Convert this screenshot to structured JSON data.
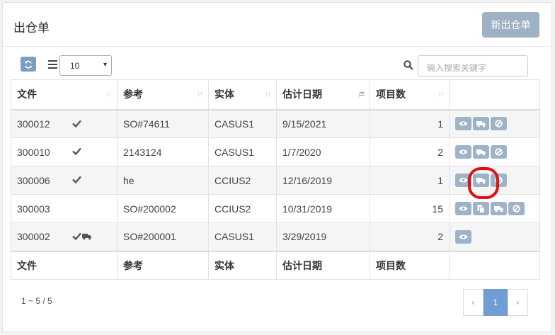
{
  "panel": {
    "title": "出仓单",
    "new_button": "新出仓单"
  },
  "toolbar": {
    "page_size": "10",
    "search_placeholder": "输入搜索关键字"
  },
  "table": {
    "headers": [
      "文件",
      "参考",
      "实体",
      "估计日期",
      "项目数"
    ],
    "rows": [
      {
        "doc": "300012",
        "ref": "SO#74611",
        "entity": "CASUS1",
        "date": "9/15/2021",
        "items": "1"
      },
      {
        "doc": "300010",
        "ref": "2143124",
        "entity": "CASUS1",
        "date": "1/7/2020",
        "items": "2"
      },
      {
        "doc": "300006",
        "ref": "he",
        "entity": "CCIUS2",
        "date": "12/16/2019",
        "items": "1"
      },
      {
        "doc": "300003",
        "ref": "SO#200002",
        "entity": "CCIUS2",
        "date": "10/31/2019",
        "items": "15"
      },
      {
        "doc": "300002",
        "ref": "SO#200001",
        "entity": "CASUS1",
        "date": "3/29/2019",
        "items": "2"
      }
    ],
    "footer": [
      "文件",
      "参考",
      "实体",
      "估计日期",
      "项目数"
    ]
  },
  "pagination": {
    "info": "1 ~ 5 / 5",
    "prev": "‹",
    "current": "1",
    "next": "›"
  },
  "colors": {
    "button": "#9fb3c8",
    "accent": "#6f9dd4",
    "highlight": "#e01010"
  }
}
